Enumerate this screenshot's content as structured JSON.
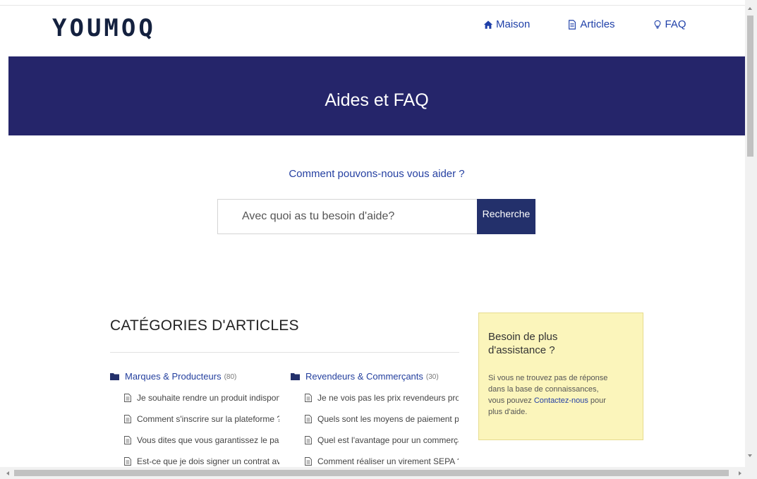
{
  "brand": {
    "logo": "YOUMOQ"
  },
  "nav": {
    "items": [
      {
        "label": "Maison",
        "icon": "home-icon"
      },
      {
        "label": "Articles",
        "icon": "document-icon"
      },
      {
        "label": "FAQ",
        "icon": "lightbulb-icon"
      }
    ]
  },
  "hero": {
    "title": "Aides et FAQ"
  },
  "search": {
    "question": "Comment pouvons-nous vous aider ?",
    "placeholder": "Avec quoi as tu besoin d'aide?",
    "button_label": "Recherche"
  },
  "categories": {
    "title": "CATÉGORIES D'ARTICLES",
    "items": [
      {
        "name": "Marques & Producteurs",
        "count": "(80)",
        "articles": [
          "Je souhaite rendre un produit indisponible \"out of stock\"",
          "Comment s'inscrire sur la plateforme ?",
          "Vous dites que vous garantissez le paiement, qu'est-ce que cela signifie ?",
          "Est-ce que je dois signer un contrat avec Youmoq ?"
        ]
      },
      {
        "name": "Revendeurs & Commerçants",
        "count": "(30)",
        "articles": [
          "Je ne vois pas les prix revendeurs proposés par les marques",
          "Quels sont les moyens de paiement proposés sur Youmoq ?",
          "Quel est l'avantage pour un commerçant d'acheter sur Youmoq ?",
          "Comment réaliser un virement SEPA ?"
        ]
      }
    ]
  },
  "assistance": {
    "title": "Besoin de plus d'assistance ?",
    "text_before": "Si vous ne trouvez pas de réponse dans la base de connaissances, vous pouvez ",
    "link_label": "Contactez-nous",
    "text_after": " pour plus d'aide."
  },
  "colors": {
    "hero_bg": "#25256a",
    "link": "#1e3fa8",
    "assist_bg": "#fbf5bb",
    "button_bg": "#23306b"
  }
}
